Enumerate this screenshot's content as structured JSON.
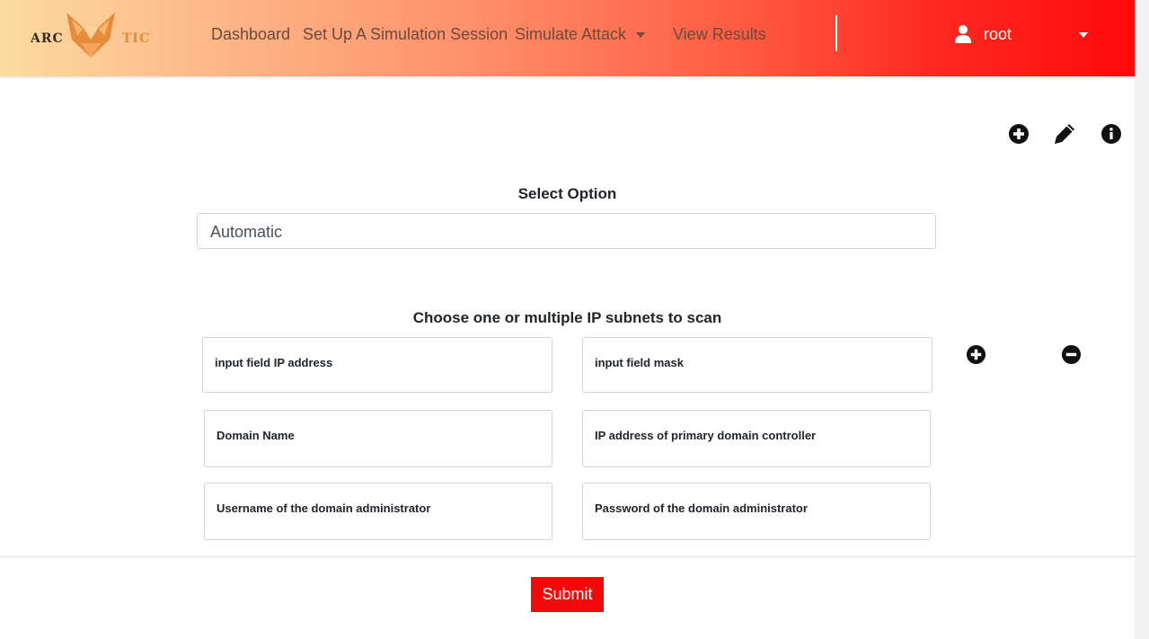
{
  "navbar": {
    "logo_text_left": "ARC",
    "logo_text_right": "TIC",
    "links": {
      "dashboard": "Dashboard",
      "setup": "Set Up A Simulation Session",
      "simulate": "Simulate Attack",
      "results": "View Results"
    },
    "user": "root"
  },
  "toolbar": {
    "icons": [
      "plus-circle-icon",
      "pencil-icon",
      "info-circle-icon"
    ]
  },
  "select": {
    "heading": "Select Option",
    "value": "Automatic"
  },
  "subnets": {
    "heading": "Choose one or multiple IP subnets to scan",
    "fields": {
      "ip": "input field IP address",
      "mask": "input field mask",
      "domain": "Domain Name",
      "pdc": "IP address of primary domain controller",
      "admin_user": "Username of the domain administrator",
      "admin_pass": "Password of the domain administrator"
    }
  },
  "submit": "Submit",
  "colors": {
    "accent": "#f20a0a",
    "navbar_start": "#fcdca0",
    "navbar_end": "#ff0a0a"
  }
}
